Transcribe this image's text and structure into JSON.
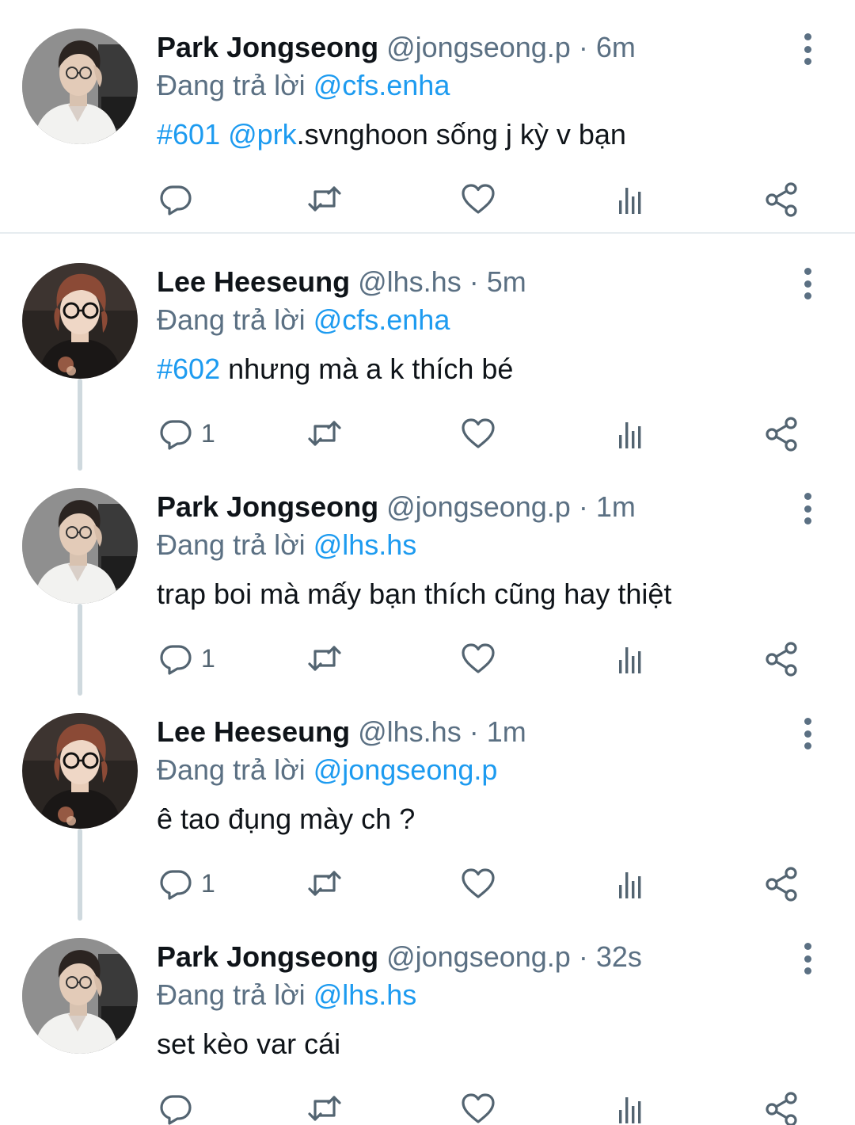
{
  "colors": {
    "mention": "#1d9bf0",
    "secondary_text": "#5b7083",
    "thread_line": "#cfd9de"
  },
  "tweets": [
    {
      "name": "Park Jongseong",
      "handle": "@jongseong.p",
      "separator": "·",
      "time": "6m",
      "reply_prefix": "Đang trả lời",
      "reply_to": "@cfs.enha",
      "text_parts": [
        {
          "text": "#601 @prk",
          "link": true
        },
        {
          "text": ".svnghoon sống j kỳ v bạn",
          "link": false
        }
      ],
      "reply_count": "",
      "avatar": "park-avatar"
    },
    {
      "name": "Lee Heeseung",
      "handle": "@lhs.hs",
      "separator": "·",
      "time": "5m",
      "reply_prefix": "Đang trả lời",
      "reply_to": "@cfs.enha",
      "text_parts": [
        {
          "text": "#602",
          "link": true
        },
        {
          "text": " nhưng mà a k thích bé",
          "link": false
        }
      ],
      "reply_count": "1",
      "avatar": "lee-avatar"
    },
    {
      "name": "Park Jongseong",
      "handle": "@jongseong.p",
      "separator": "·",
      "time": "1m",
      "reply_prefix": "Đang trả lời",
      "reply_to": "@lhs.hs",
      "text_parts": [
        {
          "text": "trap boi mà mấy bạn thích cũng hay thiệt",
          "link": false
        }
      ],
      "reply_count": "1",
      "avatar": "park-avatar"
    },
    {
      "name": "Lee Heeseung",
      "handle": "@lhs.hs",
      "separator": "·",
      "time": "1m",
      "reply_prefix": "Đang trả lời",
      "reply_to": "@jongseong.p",
      "text_parts": [
        {
          "text": "ê tao đụng mày ch ?",
          "link": false
        }
      ],
      "reply_count": "1",
      "avatar": "lee-avatar"
    },
    {
      "name": "Park Jongseong",
      "handle": "@jongseong.p",
      "separator": "·",
      "time": "32s",
      "reply_prefix": "Đang trả lời",
      "reply_to": "@lhs.hs",
      "text_parts": [
        {
          "text": "set kèo var cái",
          "link": false
        }
      ],
      "reply_count": "",
      "avatar": "park-avatar"
    }
  ]
}
